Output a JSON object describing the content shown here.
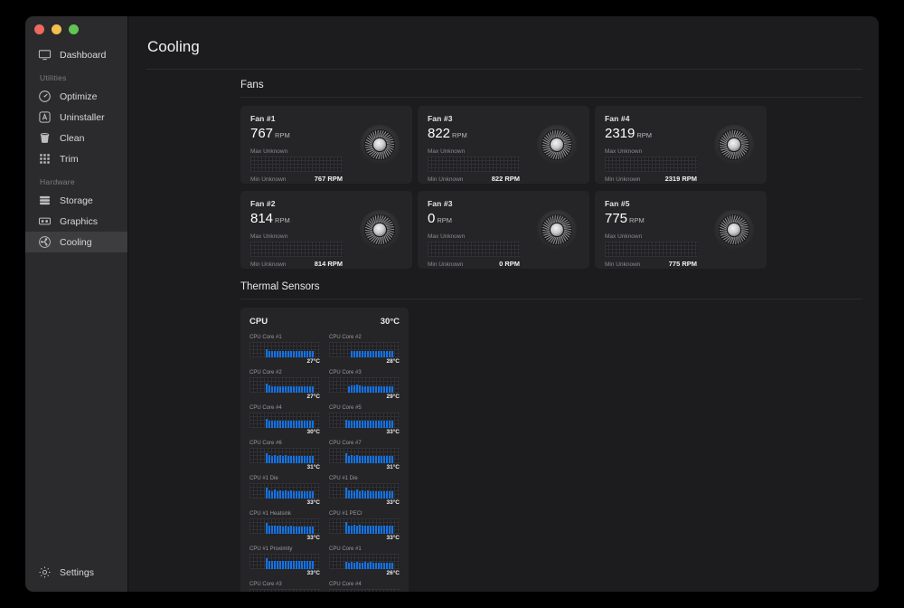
{
  "window": {
    "traffic_lights": [
      "close",
      "minimize",
      "zoom"
    ],
    "colors": {
      "accent_blue": "#1173e8",
      "sidebar_bg": "#2b2b2d",
      "card_bg": "#252528",
      "main_bg": "#1c1c1e"
    }
  },
  "sidebar": {
    "top_items": [
      {
        "label": "Dashboard",
        "icon": "monitor-icon",
        "active": false
      }
    ],
    "groups": [
      {
        "label": "Utilities",
        "items": [
          {
            "label": "Optimize",
            "icon": "speedometer-icon",
            "active": false
          },
          {
            "label": "Uninstaller",
            "icon": "app-delete-icon",
            "active": false
          },
          {
            "label": "Clean",
            "icon": "trash-icon",
            "active": false
          },
          {
            "label": "Trim",
            "icon": "grid-dots-icon",
            "active": false
          }
        ]
      },
      {
        "label": "Hardware",
        "items": [
          {
            "label": "Storage",
            "icon": "drive-stack-icon",
            "active": false
          },
          {
            "label": "Graphics",
            "icon": "gpu-card-icon",
            "active": false
          },
          {
            "label": "Cooling",
            "icon": "fan-icon",
            "active": true
          }
        ]
      }
    ],
    "settings": {
      "label": "Settings",
      "icon": "gear-icon"
    }
  },
  "main": {
    "page_title": "Cooling",
    "fans_section_title": "Fans",
    "thermal_section_title": "Thermal Sensors",
    "fans": [
      {
        "name": "Fan #1",
        "value": "767",
        "unit": "RPM",
        "max_label": "Max Unknown",
        "min_label": "Min Unknown",
        "current": "767 RPM"
      },
      {
        "name": "Fan #3",
        "value": "822",
        "unit": "RPM",
        "max_label": "Max Unknown",
        "min_label": "Min Unknown",
        "current": "822 RPM"
      },
      {
        "name": "Fan #4",
        "value": "2319",
        "unit": "RPM",
        "max_label": "Max Unknown",
        "min_label": "Min Unknown",
        "current": "2319 RPM"
      },
      {
        "name": "Fan #2",
        "value": "814",
        "unit": "RPM",
        "max_label": "Max Unknown",
        "min_label": "Min Unknown",
        "current": "814 RPM"
      },
      {
        "name": "Fan #3",
        "value": "0",
        "unit": "RPM",
        "max_label": "Max Unknown",
        "min_label": "Min Unknown",
        "current": "0 RPM"
      },
      {
        "name": "Fan #5",
        "value": "775",
        "unit": "RPM",
        "max_label": "Max Unknown",
        "min_label": "Min Unknown",
        "current": "775 RPM"
      }
    ],
    "thermal": {
      "group_name": "CPU",
      "group_value": "30°C",
      "sensors": [
        {
          "name": "CPU Core #1",
          "value": "27°C",
          "start": 6,
          "levels": [
            9,
            7,
            7,
            7,
            7,
            7,
            7,
            7,
            7,
            7,
            7,
            7,
            7,
            7,
            7,
            7,
            7,
            7
          ]
        },
        {
          "name": "CPU Core #2",
          "value": "28°C",
          "start": 8,
          "levels": [
            7,
            7,
            7,
            7,
            7,
            7,
            7,
            7,
            7,
            7,
            7,
            7,
            7,
            7,
            7,
            7
          ]
        },
        {
          "name": "CPU Core #2",
          "value": "27°C",
          "start": 6,
          "levels": [
            10,
            8,
            7,
            7,
            7,
            7,
            7,
            7,
            7,
            7,
            7,
            7,
            7,
            7,
            7,
            7,
            7,
            7
          ]
        },
        {
          "name": "CPU Core #3",
          "value": "29°C",
          "start": 7,
          "levels": [
            7,
            8,
            8,
            9,
            8,
            7,
            7,
            7,
            7,
            7,
            7,
            7,
            7,
            7,
            7,
            7,
            7
          ]
        },
        {
          "name": "CPU Core #4",
          "value": "30°C",
          "start": 6,
          "levels": [
            10,
            8,
            8,
            8,
            8,
            8,
            8,
            8,
            8,
            8,
            8,
            8,
            8,
            8,
            8,
            8,
            8,
            8
          ]
        },
        {
          "name": "CPU Core #5",
          "value": "33°C",
          "start": 6,
          "levels": [
            9,
            8,
            8,
            8,
            8,
            8,
            8,
            8,
            8,
            8,
            8,
            8,
            8,
            8,
            8,
            8,
            8,
            8
          ]
        },
        {
          "name": "CPU Core #6",
          "value": "31°C",
          "start": 6,
          "levels": [
            11,
            9,
            8,
            9,
            8,
            9,
            8,
            9,
            8,
            8,
            8,
            8,
            8,
            8,
            8,
            8,
            8,
            8
          ]
        },
        {
          "name": "CPU Core #7",
          "value": "31°C",
          "start": 6,
          "levels": [
            11,
            8,
            9,
            8,
            9,
            8,
            8,
            8,
            8,
            8,
            8,
            8,
            8,
            8,
            8,
            8,
            8,
            8
          ]
        },
        {
          "name": "CPU #1 Die",
          "value": "33°C",
          "start": 6,
          "levels": [
            12,
            9,
            8,
            10,
            8,
            9,
            8,
            9,
            8,
            9,
            8,
            8,
            8,
            8,
            8,
            8,
            8,
            8
          ]
        },
        {
          "name": "CPU #1 Die",
          "value": "33°C",
          "start": 6,
          "levels": [
            12,
            9,
            9,
            8,
            10,
            8,
            9,
            8,
            9,
            8,
            8,
            8,
            8,
            8,
            8,
            8,
            8,
            8
          ]
        },
        {
          "name": "CPU #1 Heatsink",
          "value": "33°C",
          "start": 6,
          "levels": [
            12,
            9,
            9,
            9,
            9,
            9,
            8,
            9,
            8,
            9,
            8,
            8,
            8,
            8,
            8,
            8,
            8,
            8
          ]
        },
        {
          "name": "CPU #1 PECI",
          "value": "33°C",
          "start": 6,
          "levels": [
            13,
            9,
            9,
            10,
            9,
            10,
            9,
            9,
            9,
            9,
            9,
            9,
            9,
            9,
            9,
            9,
            9,
            9
          ]
        },
        {
          "name": "CPU #1 Proximity",
          "value": "33°C",
          "start": 6,
          "levels": [
            12,
            9,
            9,
            9,
            9,
            9,
            9,
            9,
            9,
            9,
            9,
            9,
            9,
            9,
            9,
            9,
            9,
            9
          ]
        },
        {
          "name": "CPU Core #1",
          "value": "26°C",
          "start": 6,
          "levels": [
            8,
            7,
            8,
            7,
            8,
            7,
            7,
            8,
            7,
            8,
            7,
            7,
            7,
            7,
            7,
            7,
            7,
            7
          ]
        },
        {
          "name": "CPU Core #3",
          "value": "",
          "start": 6,
          "levels": [
            8,
            8,
            8,
            8,
            8,
            8,
            8,
            8,
            8,
            8,
            8,
            8,
            8,
            8,
            8,
            8,
            8,
            8
          ]
        },
        {
          "name": "CPU Core #4",
          "value": "",
          "start": 7,
          "levels": [
            7,
            9,
            8,
            7,
            7,
            7,
            7,
            7,
            7,
            7,
            7,
            7,
            7,
            7,
            7,
            7,
            7
          ]
        }
      ]
    }
  }
}
